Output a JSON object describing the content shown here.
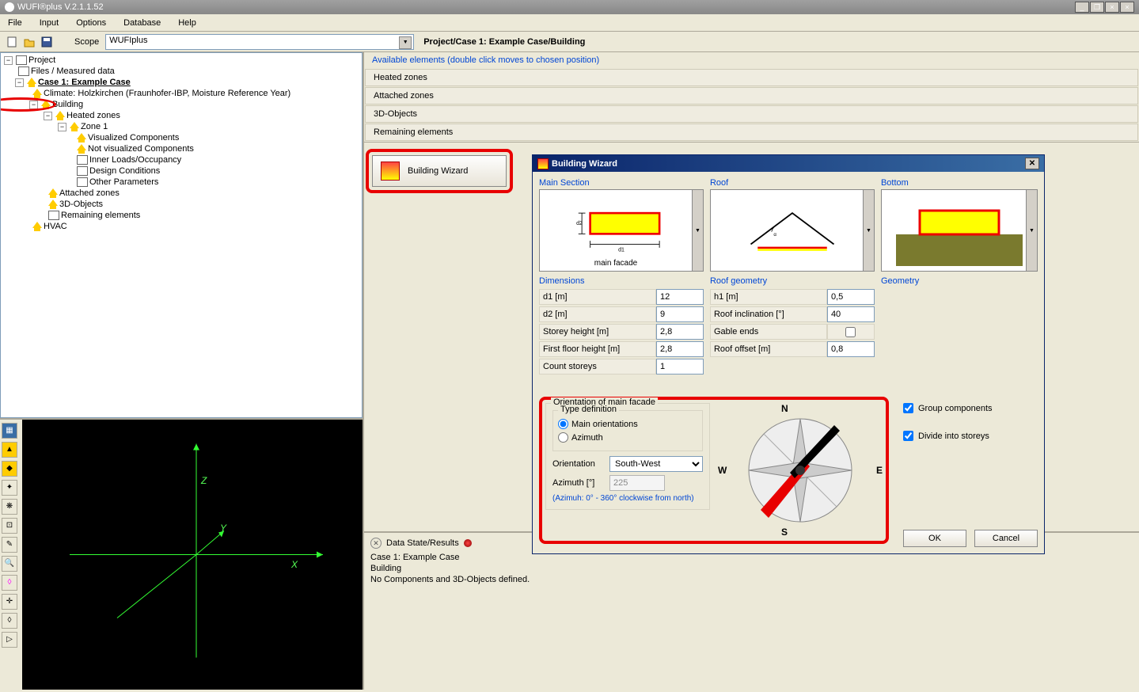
{
  "app": {
    "title": "WUFI®plus V.2.1.1.52"
  },
  "window_buttons": [
    "_",
    "❐",
    "×",
    "×"
  ],
  "menubar": [
    "File",
    "Input",
    "Options",
    "Database",
    "Help"
  ],
  "toolbar": {
    "scope_label": "Scope",
    "scope_value": "WUFIplus",
    "breadcrumb": "Project/Case 1: Example Case/Building"
  },
  "tree": {
    "root": "Project",
    "files": "Files / Measured data",
    "case": "Case 1: Example Case",
    "climate": "Climate: Holzkirchen (Fraunhofer-IBP, Moisture Reference Year)",
    "building": "Building",
    "heated": "Heated zones",
    "zone1": "Zone 1",
    "viscomp": "Visualized Components",
    "nonviscomp": "Not visualized Components",
    "innerloads": "Inner Loads/Occupancy",
    "designcond": "Design Conditions",
    "otherparam": "Other Parameters",
    "attached": "Attached zones",
    "objects3d": "3D-Objects",
    "remaining": "Remaining elements",
    "hvac": "HVAC"
  },
  "viewer": {
    "axes": {
      "x": "X",
      "y": "Y",
      "z": "Z"
    }
  },
  "available": {
    "header": "Available elements (double click moves to chosen position)",
    "rows": [
      "Heated zones",
      "Attached zones",
      "3D-Objects",
      "Remaining elements"
    ]
  },
  "wizard_btn_label": "Building Wizard",
  "status": {
    "header": "Data State/Results",
    "line1": "Case 1: Example Case",
    "line2": "Building",
    "line3": "No Components and 3D-Objects defined."
  },
  "dialog": {
    "title": "Building Wizard",
    "sections": {
      "main": "Main Section",
      "roof": "Roof",
      "bottom": "Bottom"
    },
    "main_facade_label": "main facade",
    "dimensions_header": "Dimensions",
    "dims": {
      "d1": {
        "label": "d1  [m]",
        "value": "12"
      },
      "d2": {
        "label": "d2  [m]",
        "value": "9"
      },
      "storey": {
        "label": "Storey height  [m]",
        "value": "2,8"
      },
      "firstfloor": {
        "label": "First floor height  [m]",
        "value": "2,8"
      },
      "count": {
        "label": "Count storeys",
        "value": "1"
      }
    },
    "roof_header": "Roof geometry",
    "roof": {
      "h1": {
        "label": "h1  [m]",
        "value": "0,5"
      },
      "incl": {
        "label": "Roof inclination  [°]",
        "value": "40"
      },
      "gable": {
        "label": "Gable ends"
      },
      "offset": {
        "label": "Roof offset  [m]",
        "value": "0,8"
      }
    },
    "geometry_header": "Geometry",
    "orientation": {
      "legend": "Orientation of main facade",
      "typedef": "Type definition",
      "radio_main": "Main orientations",
      "radio_azimuth": "Azimuth",
      "orient_label": "Orientation",
      "orient_value": "South-West",
      "azimuth_label": "Azimuth [°]",
      "azimuth_value": "225",
      "hint": "(Azimuh: 0° - 360° clockwise from north)",
      "compass": {
        "n": "N",
        "s": "S",
        "e": "E",
        "w": "W"
      }
    },
    "group": "Group components",
    "divide": "Divide into storeys",
    "ok": "OK",
    "cancel": "Cancel"
  }
}
